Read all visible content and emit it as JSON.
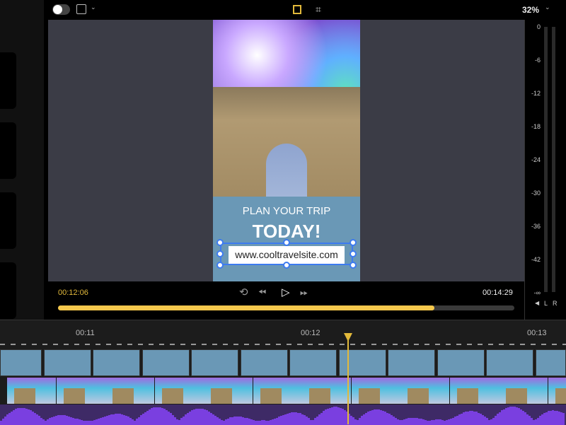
{
  "toolbar": {
    "zoom_level": "32%",
    "zoom_icon": "chevron-down-icon"
  },
  "preview": {
    "headline": "PLAN YOUR TRIP",
    "subheadline": "TODAY!",
    "url_text": "www.cooltravelsite.com"
  },
  "playback": {
    "current_time": "00:12:06",
    "total_time": "00:14:29",
    "progress_percent": 82.5,
    "accent": "#f5c84c"
  },
  "meter": {
    "labels": [
      "0",
      "-6",
      "-12",
      "-18",
      "-24",
      "-30",
      "-36",
      "-42",
      "-∞"
    ],
    "left_label": "L",
    "right_label": "R"
  },
  "timeline": {
    "ticks": [
      "00:11",
      "00:12",
      "00:13"
    ]
  }
}
